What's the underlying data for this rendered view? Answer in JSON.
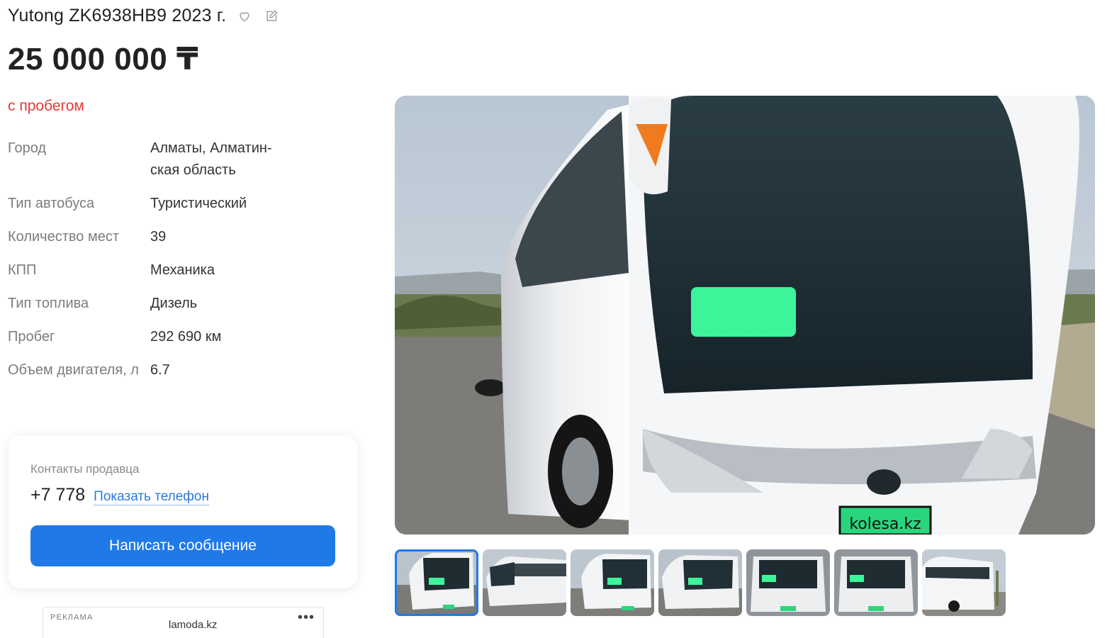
{
  "header": {
    "title": "Yutong ZK6938HB9 2023 г.",
    "favorite_icon": "heart-icon",
    "edit_icon": "edit-note-icon",
    "price": "25 000 000 ₸",
    "condition": "с пробегом"
  },
  "specs": [
    {
      "key": "Город",
      "value": "Алматы, Алматин-ская область"
    },
    {
      "key": "Тип автобуса",
      "value": "Туристический"
    },
    {
      "key": "Количество мест",
      "value": "39"
    },
    {
      "key": "КПП",
      "value": "Механика"
    },
    {
      "key": "Тип топлива",
      "value": "Дизель"
    },
    {
      "key": "Пробег",
      "value": "292 690 км"
    },
    {
      "key": "Объем двигателя, л",
      "value": "6.7"
    }
  ],
  "contacts": {
    "label": "Контакты продавца",
    "phone": "+7 778",
    "show_phone": "Показать телефон",
    "message_button": "Написать сообщение"
  },
  "ad": {
    "label": "РЕКЛАМА",
    "site": "lamoda.kz",
    "more": "•••"
  },
  "gallery": {
    "main_plate_text": "kolesa.kz",
    "thumbnail_count": 7,
    "active_index": 0
  },
  "colors": {
    "accent": "#1f7ae8",
    "condition": "#e53935",
    "link": "#2a7ad6"
  }
}
